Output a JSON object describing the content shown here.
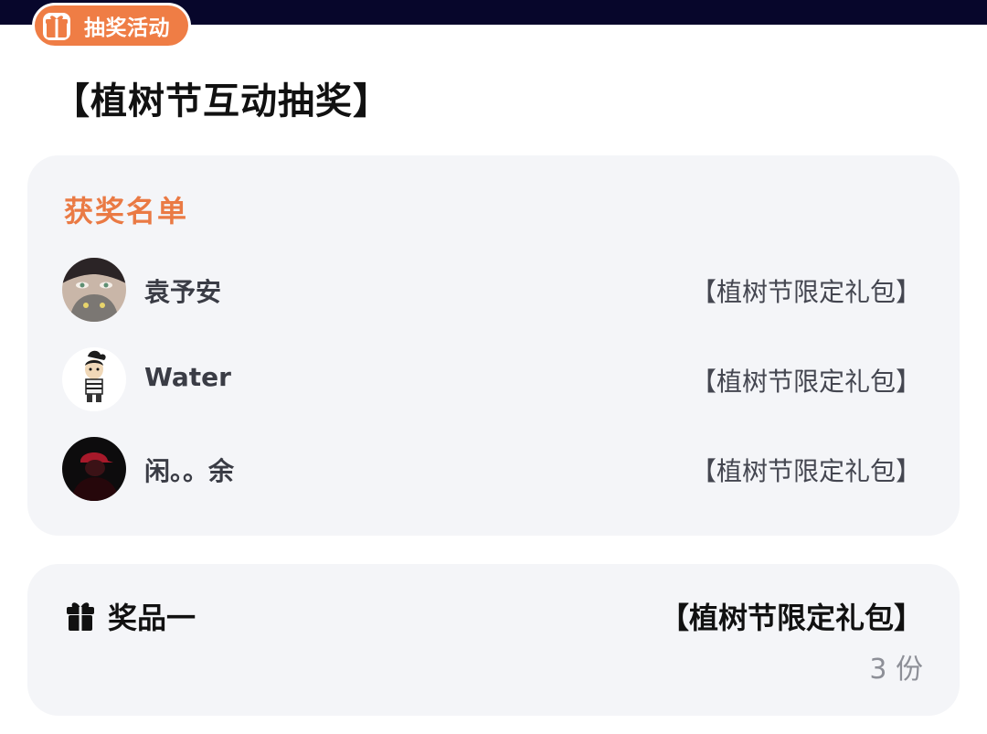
{
  "header": {
    "badge_label": "抽奖活动",
    "title": "【植树节互动抽奖】"
  },
  "winners": {
    "heading": "获奖名单",
    "items": [
      {
        "name": "袁予安",
        "prize": "【植树节限定礼包】",
        "avatar": "anime-girl-with-cat"
      },
      {
        "name": "Water",
        "prize": "【植树节限定礼包】",
        "avatar": "cartoon-boy"
      },
      {
        "name": "闲。。余",
        "prize": "【植树节限定礼包】",
        "avatar": "red-figure-dark"
      }
    ]
  },
  "prize": {
    "label": "奖品一",
    "name": "【植树节限定礼包】",
    "count": "3 份",
    "icon": "gift-icon"
  },
  "colors": {
    "accent": "#ef7d45",
    "heading_orange": "#ea7a44",
    "top_bar": "#07062b",
    "card_bg": "#f4f5f8"
  }
}
